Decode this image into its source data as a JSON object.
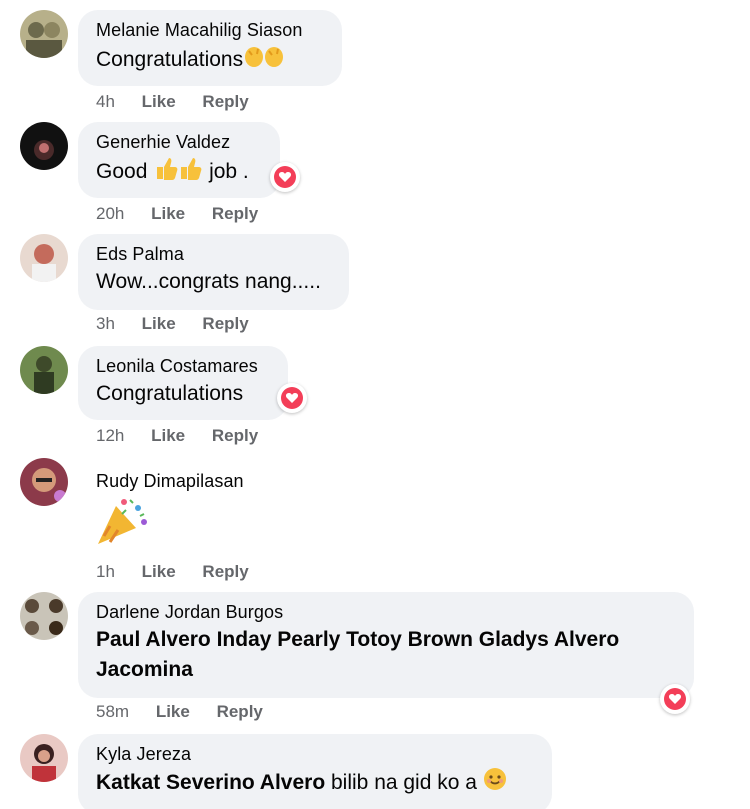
{
  "comments": [
    {
      "author": "Melanie Macahilig Siason",
      "text": "Congratulations",
      "emoji": "clapping-hands",
      "time": "4h",
      "like": "Like",
      "reply": "Reply"
    },
    {
      "author": "Generhie Valdez",
      "text_before": "Good",
      "emoji": "thumbs-up",
      "text_after": "job .",
      "time": "20h",
      "like": "Like",
      "reply": "Reply",
      "reaction": "love"
    },
    {
      "author": "Eds Palma",
      "text": "Wow...congrats nang.....",
      "time": "3h",
      "like": "Like",
      "reply": "Reply"
    },
    {
      "author": "Leonila Costamares",
      "text": "Congratulations",
      "time": "12h",
      "like": "Like",
      "reply": "Reply",
      "reaction": "love"
    },
    {
      "author": "Rudy Dimapilasan",
      "emoji": "party-popper",
      "time": "1h",
      "like": "Like",
      "reply": "Reply"
    },
    {
      "author": "Darlene Jordan Burgos",
      "mentions_line1": "Paul Alvero Inday Pearly Totoy Brown Gladys Alvero",
      "mentions_line2": "Jacomina",
      "time": "58m",
      "like": "Like",
      "reply": "Reply",
      "reaction": "love"
    },
    {
      "author": "Kyla Jereza",
      "mention": "Katkat Severino Alvero",
      "text": "bilib na gid ko a",
      "emoji": "smiling-face"
    }
  ],
  "colors": {
    "bubble": "#f0f2f5",
    "meta": "#65676b",
    "heart": "#f33e58",
    "text": "#050505"
  }
}
